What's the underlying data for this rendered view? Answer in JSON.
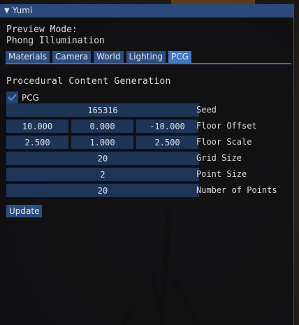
{
  "window": {
    "title": "Yumi"
  },
  "preview": {
    "label": "Preview Mode:",
    "value": "Phong Illumination"
  },
  "tabs": [
    {
      "label": "Materials",
      "active": false
    },
    {
      "label": "Camera",
      "active": false
    },
    {
      "label": "World",
      "active": false
    },
    {
      "label": "Lighting",
      "active": false
    },
    {
      "label": "PCG",
      "active": true
    }
  ],
  "pcg": {
    "section_title": "Procedural Content Generation",
    "enabled_label": "PCG",
    "enabled": true,
    "seed": {
      "label": "Seed",
      "value": "165316"
    },
    "floor_offset": {
      "label": "Floor Offset",
      "values": [
        "10.000",
        "0.000",
        "-10.000"
      ]
    },
    "floor_scale": {
      "label": "Floor Scale",
      "values": [
        "2.500",
        "1.000",
        "2.500"
      ]
    },
    "grid_size": {
      "label": "Grid Size",
      "value": "20"
    },
    "point_size": {
      "label": "Point Size",
      "value": "2"
    },
    "num_points": {
      "label": "Number of Points",
      "value": "20"
    },
    "update_label": "Update"
  },
  "colors": {
    "title_bar": "#294a7a",
    "tab": "#2c4d80",
    "tab_active": "#4277c2",
    "field": "#1f3558",
    "check": "#4a90e2"
  }
}
